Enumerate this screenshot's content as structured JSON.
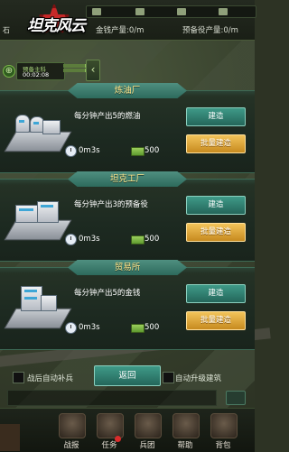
{
  "header": {
    "game_logo": "坦克风云",
    "side_label": "石",
    "money_rate": "金钱产量:0/m",
    "reserve_rate": "预备役产量:0/m"
  },
  "military": {
    "label": "预备主科",
    "timer": "00:02:08"
  },
  "buildings": [
    {
      "title": "炼油厂",
      "desc": "每分钟产出5的燃油",
      "time": "0m3s",
      "cost": "500",
      "build_label": "建造",
      "batch_label": "批量建造"
    },
    {
      "title": "坦克工厂",
      "desc": "每分钟产出3的预备役",
      "time": "0m3s",
      "cost": "500",
      "build_label": "建造",
      "batch_label": "批量建造"
    },
    {
      "title": "贸易所",
      "desc": "每分钟产出5的金钱",
      "time": "0m3s",
      "cost": "500",
      "build_label": "建造",
      "batch_label": "批量建造"
    }
  ],
  "controls": {
    "auto_replenish": "战后自动补兵",
    "back": "返回",
    "auto_upgrade": "自动升级建筑"
  },
  "nav": [
    {
      "label": "战报",
      "icon": "report-icon"
    },
    {
      "label": "任务",
      "icon": "task-icon",
      "badge": true
    },
    {
      "label": "兵团",
      "icon": "legion-icon"
    },
    {
      "label": "帮助",
      "icon": "help-icon"
    },
    {
      "label": "背包",
      "icon": "backpack-icon"
    }
  ],
  "colors": {
    "title_gold": "#ffe48a",
    "build_teal": "#3f9a88",
    "batch_gold": "#f2c35a",
    "badge_red": "#d92b2b"
  }
}
